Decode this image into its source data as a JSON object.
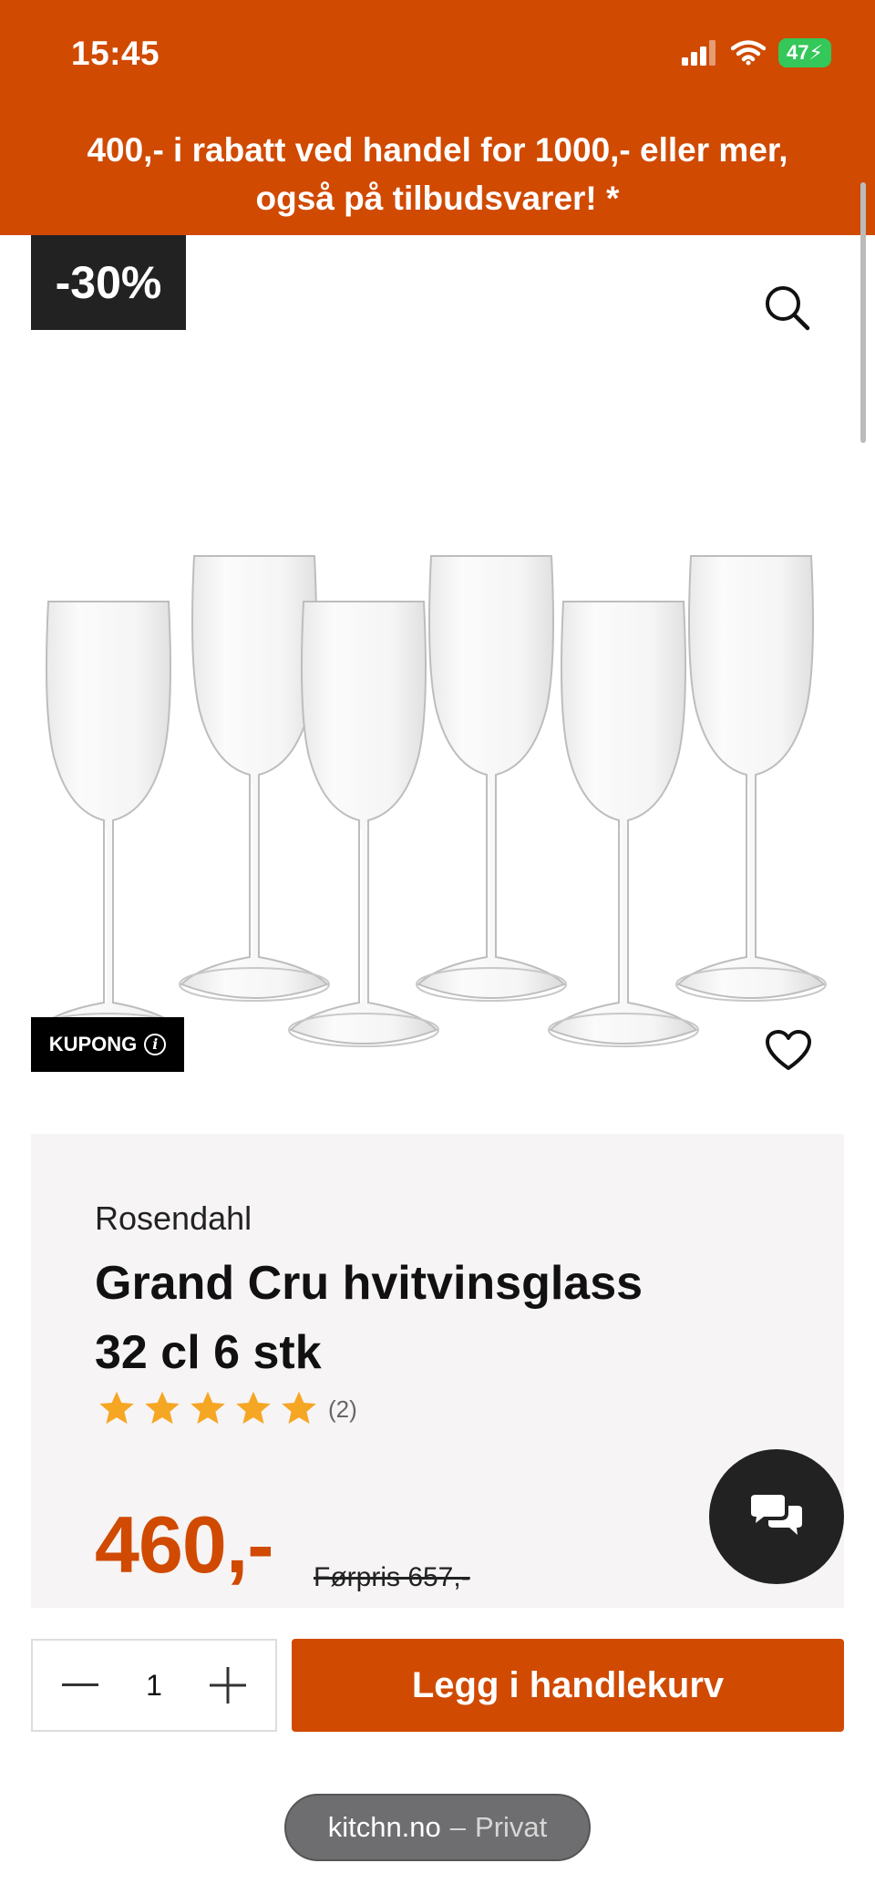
{
  "status_bar": {
    "time": "15:45",
    "battery": "47"
  },
  "promo": {
    "line1": "400,- i rabatt ved handel for 1000,- eller mer,",
    "line2": "også på tilbudsvarer! *"
  },
  "badges": {
    "discount": "-30%",
    "coupon": "KUPONG",
    "coupon_info": "i"
  },
  "product": {
    "brand": "Rosendahl",
    "title_line1": "Grand Cru hvitvinsglass",
    "title_line2": "32 cl 6 stk",
    "rating": {
      "stars": 5,
      "max": 5,
      "count": "(2)"
    },
    "price": "460,-",
    "old_price": "Førpris 657,-"
  },
  "cart": {
    "quantity": "1",
    "add_label": "Legg i handlekurv"
  },
  "url_bar": {
    "domain": "kitchn.no",
    "separator": "–",
    "mode": "Privat"
  },
  "icons": [
    "signal-icon",
    "wifi-icon",
    "battery-icon",
    "search-icon",
    "info-icon",
    "heart-icon",
    "star-icon",
    "chat-icon",
    "minus-icon",
    "plus-icon"
  ],
  "colors": {
    "brand_orange": "#d04a02",
    "dark": "#222222",
    "star": "#f5a623",
    "card_bg": "#f6f4f4",
    "battery_green": "#34c759"
  }
}
